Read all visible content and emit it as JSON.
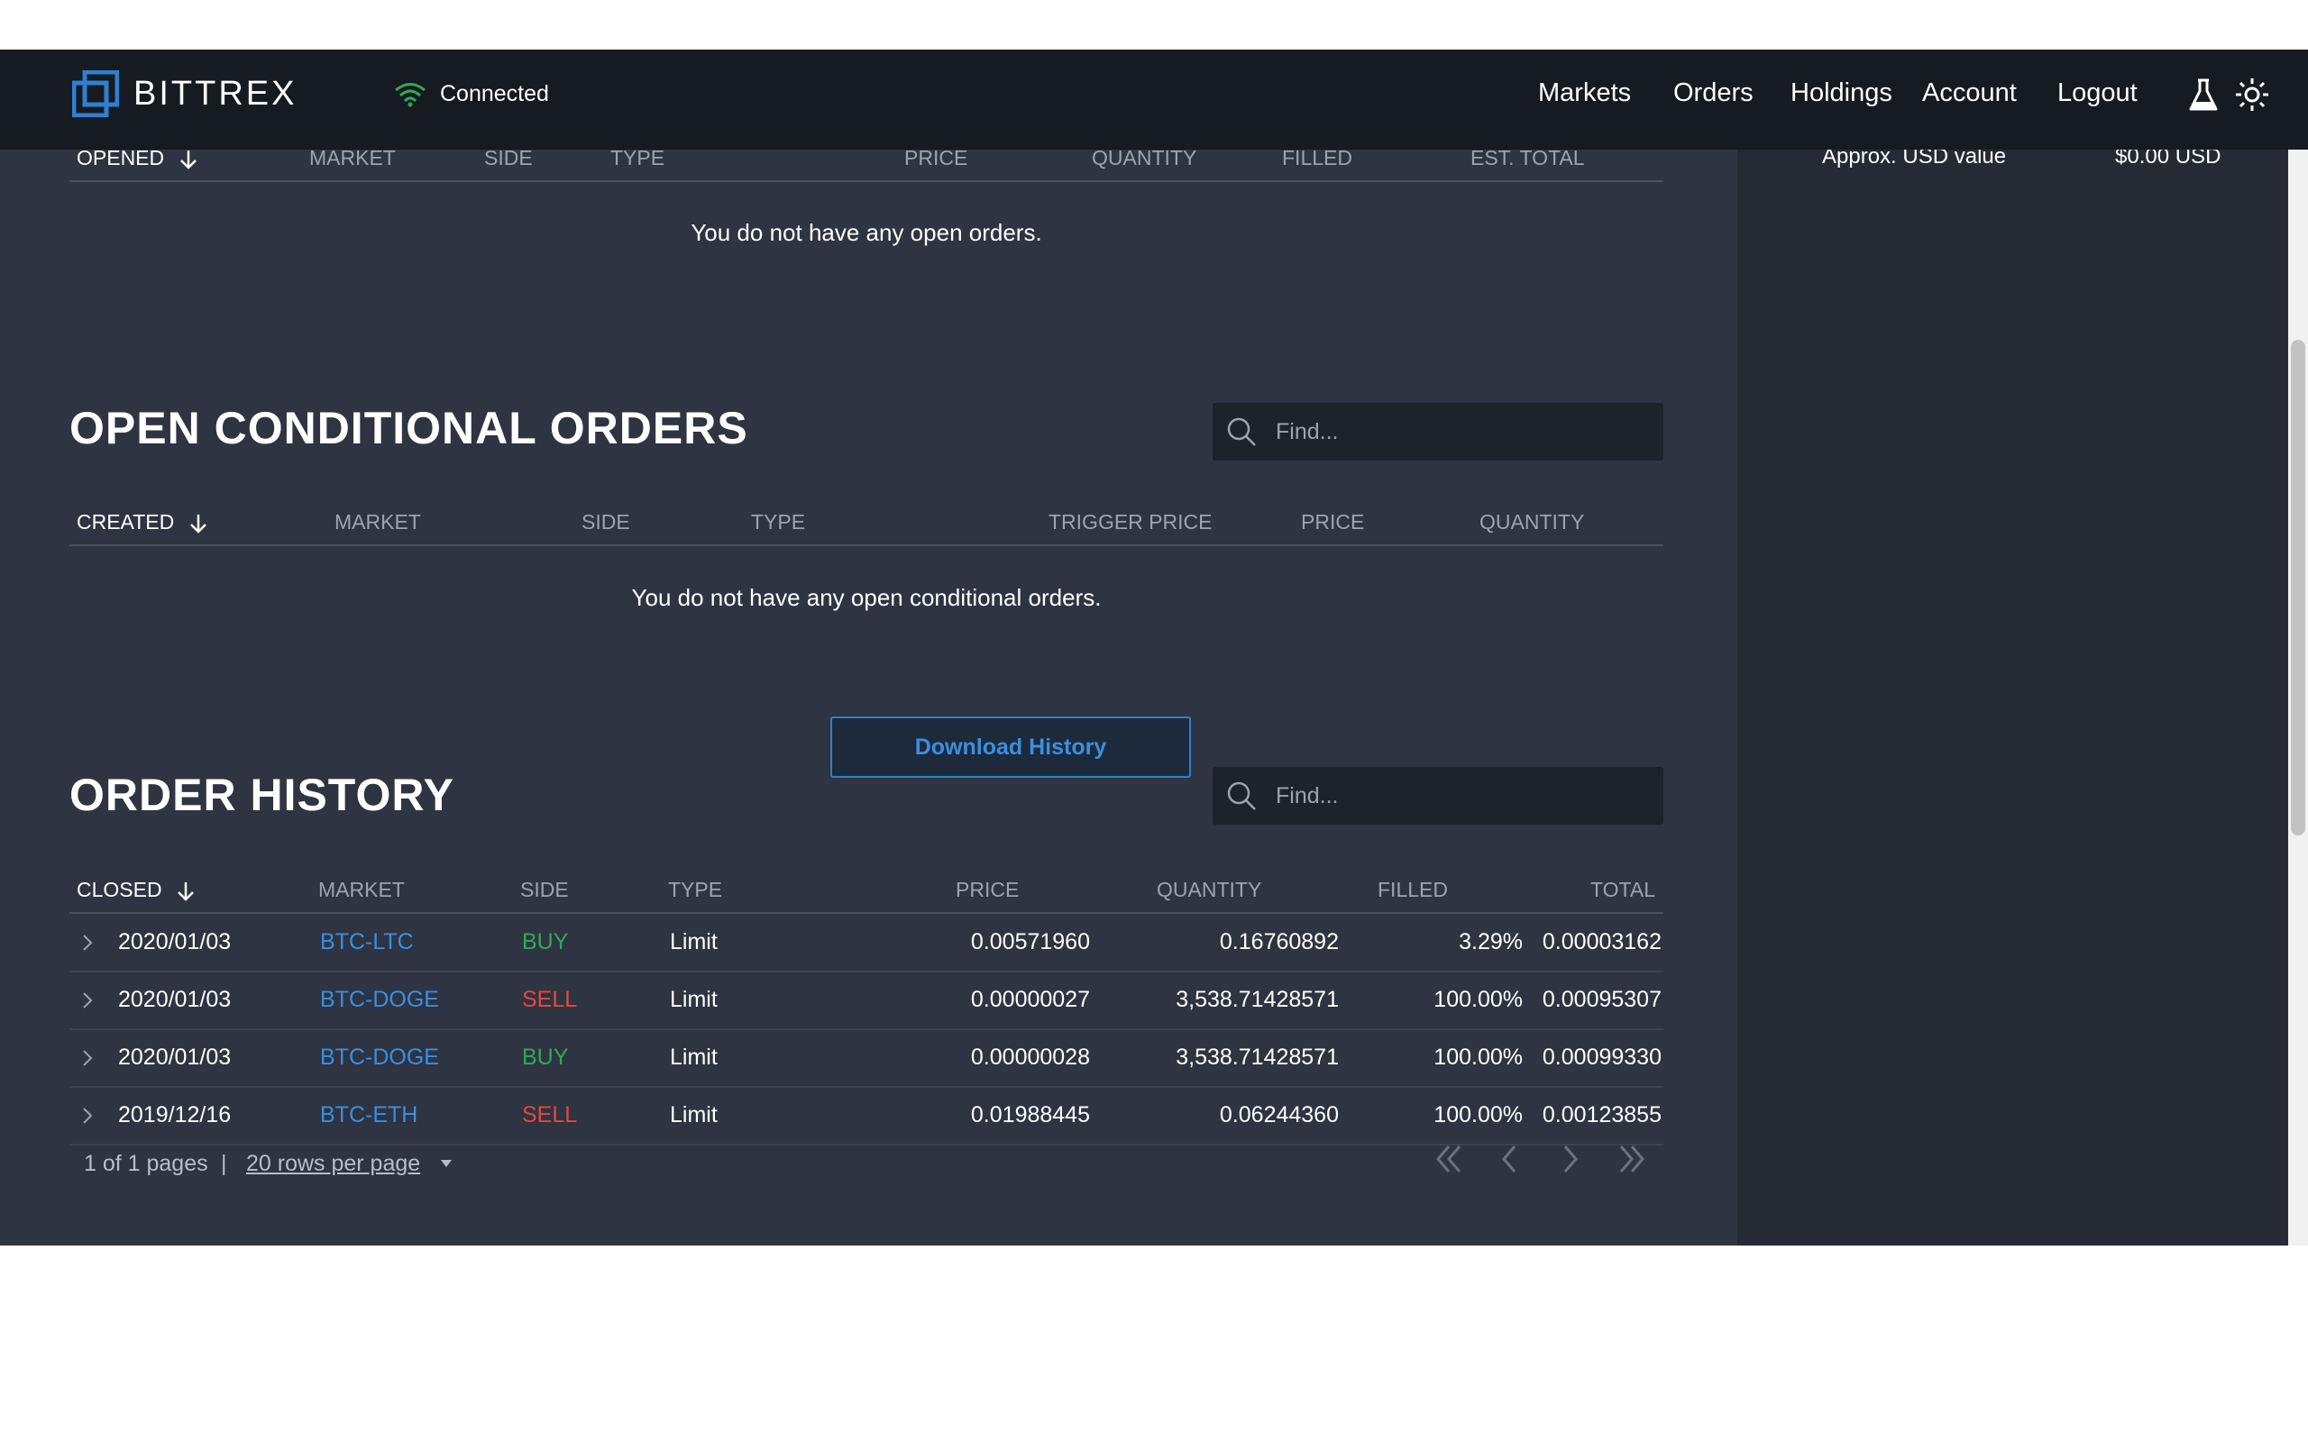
{
  "navbar": {
    "brand": "BITTREX",
    "status": "Connected",
    "links": [
      "Markets",
      "Orders",
      "Holdings",
      "Account",
      "Logout"
    ],
    "icons": [
      "lab-flask-icon",
      "theme-sun-icon"
    ]
  },
  "right_panel": {
    "usd_label": "Approx. USD value",
    "usd_value": "$0.00 USD"
  },
  "open_orders": {
    "headers": [
      "OPENED",
      "MARKET",
      "SIDE",
      "TYPE",
      "PRICE",
      "QUANTITY",
      "FILLED",
      "EST. TOTAL"
    ],
    "empty_message": "You do not have any open orders."
  },
  "conditional_orders": {
    "title": "OPEN CONDITIONAL ORDERS",
    "search_placeholder": "Find...",
    "headers": [
      "CREATED",
      "MARKET",
      "SIDE",
      "TYPE",
      "TRIGGER PRICE",
      "PRICE",
      "QUANTITY"
    ],
    "empty_message": "You do not have any open conditional orders."
  },
  "order_history": {
    "title": "ORDER HISTORY",
    "download_label": "Download History",
    "search_placeholder": "Find...",
    "headers": [
      "CLOSED",
      "MARKET",
      "SIDE",
      "TYPE",
      "PRICE",
      "QUANTITY",
      "FILLED",
      "TOTAL"
    ],
    "rows": [
      {
        "closed": "2020/01/03",
        "market": "BTC-LTC",
        "side": "BUY",
        "type": "Limit",
        "price": "0.00571960",
        "quantity": "0.16760892",
        "filled": "3.29%",
        "total": "0.00003162"
      },
      {
        "closed": "2020/01/03",
        "market": "BTC-DOGE",
        "side": "SELL",
        "type": "Limit",
        "price": "0.00000027",
        "quantity": "3,538.71428571",
        "filled": "100.00%",
        "total": "0.00095307"
      },
      {
        "closed": "2020/01/03",
        "market": "BTC-DOGE",
        "side": "BUY",
        "type": "Limit",
        "price": "0.00000028",
        "quantity": "3,538.71428571",
        "filled": "100.00%",
        "total": "0.00099330"
      },
      {
        "closed": "2019/12/16",
        "market": "BTC-ETH",
        "side": "SELL",
        "type": "Limit",
        "price": "0.01988445",
        "quantity": "0.06244360",
        "filled": "100.00%",
        "total": "0.00123855"
      }
    ],
    "pagination": {
      "page_info": "1 of 1 pages",
      "separator": "|",
      "rows_per_page": "20 rows per page"
    }
  },
  "colors": {
    "background": "#2e3441",
    "navbar": "#161a21",
    "accent": "#3a8fe0",
    "buy": "#34a853",
    "sell": "#e8473f",
    "status_green": "#34a853"
  }
}
